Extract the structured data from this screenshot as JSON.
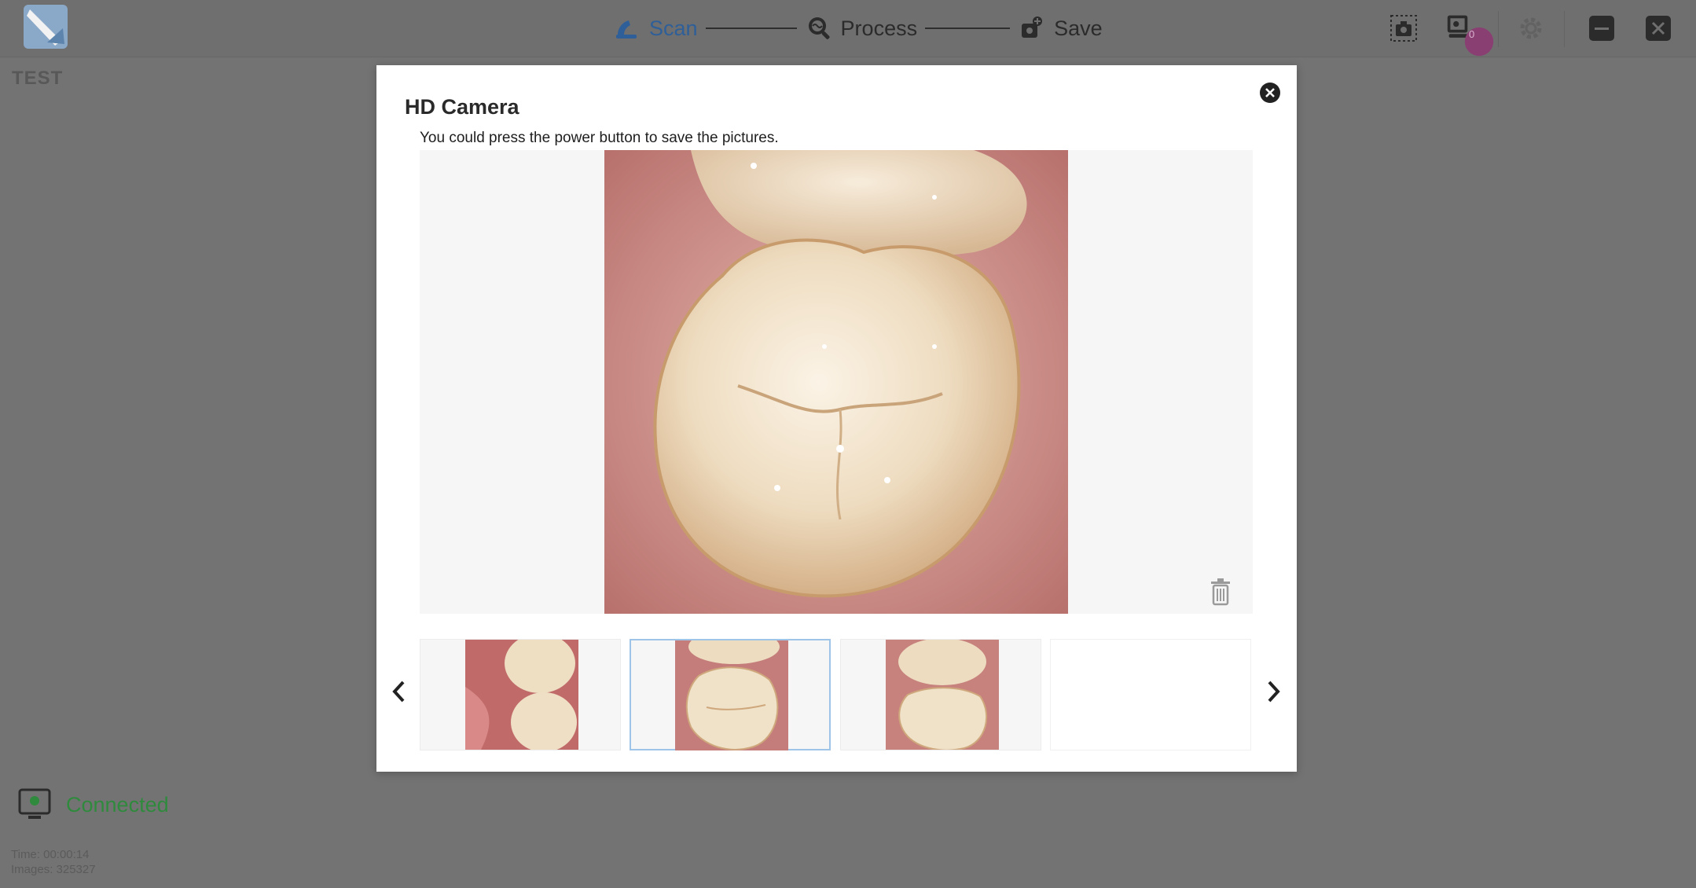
{
  "workspace": {
    "title": "TEST"
  },
  "steps": [
    {
      "label": "Scan",
      "icon": "scan-icon",
      "active": true
    },
    {
      "label": "Process",
      "icon": "process-icon",
      "active": false
    },
    {
      "label": "Save",
      "icon": "save-icon",
      "active": false
    }
  ],
  "toolbar": {
    "icons": [
      "screenshot-icon",
      "camera-gallery-icon",
      "settings-icon",
      "minimize-icon",
      "close-icon"
    ],
    "gallery_badge": "0"
  },
  "status": {
    "label": "Connected"
  },
  "stats": {
    "time": "Time: 00:00:14",
    "images": "Images: 325327"
  },
  "dialog": {
    "title": "HD Camera",
    "hint": "You could press the power button to save the pictures.",
    "thumbnails": [
      {
        "name": "thumbnail-1",
        "selected": false
      },
      {
        "name": "thumbnail-2",
        "selected": true
      },
      {
        "name": "thumbnail-3",
        "selected": false
      },
      {
        "name": "thumbnail-4",
        "selected": false,
        "empty": true
      }
    ]
  },
  "colors": {
    "accent": "#2f5f98",
    "connected": "#2f8a3d",
    "overlay": "#737373",
    "selected_border": "#9ec5e8"
  }
}
